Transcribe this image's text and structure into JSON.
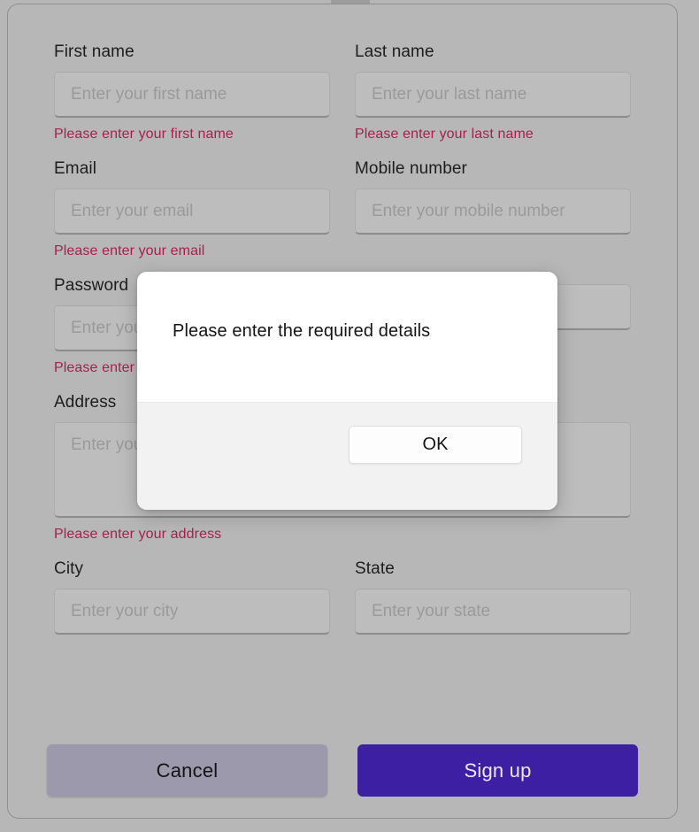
{
  "window": {
    "background_color": "#b7b7b7",
    "border_color": "#8f8f8f"
  },
  "form": {
    "fields": [
      {
        "name": "first-name",
        "label": "First name",
        "placeholder": "Enter your first name",
        "value": "",
        "error": "Please enter your first name",
        "type": "text"
      },
      {
        "name": "last-name",
        "label": "Last name",
        "placeholder": "Enter your last name",
        "value": "",
        "error": "Please enter your last name",
        "type": "text"
      },
      {
        "name": "email",
        "label": "Email",
        "placeholder": "Enter your email",
        "value": "",
        "error": "Please enter your email",
        "type": "text"
      },
      {
        "name": "mobile-number",
        "label": "Mobile number",
        "placeholder": "Enter your mobile number",
        "value": "",
        "error": "",
        "type": "text"
      },
      {
        "name": "password",
        "label": "Password",
        "placeholder": "Enter your password",
        "value": "",
        "error": "Please enter your password",
        "type": "password"
      },
      {
        "name": "confirm-password",
        "label": "",
        "placeholder": "",
        "value": "",
        "error": "",
        "type": "text"
      },
      {
        "name": "address",
        "label": "Address",
        "placeholder": "Enter your address",
        "value": "",
        "error": "Please enter your address",
        "type": "textarea"
      },
      {
        "name": "city",
        "label": "City",
        "placeholder": "Enter your city",
        "value": "",
        "error": "",
        "type": "text"
      },
      {
        "name": "state",
        "label": "State",
        "placeholder": "Enter your state",
        "value": "",
        "error": "",
        "type": "text"
      }
    ],
    "error_color": "#a8204c"
  },
  "actions": {
    "cancel_label": "Cancel",
    "signup_label": "Sign up",
    "cancel_color": "#9c99ad",
    "signup_color": "#3d1fa3"
  },
  "dialog": {
    "message": "Please enter the required details",
    "ok_label": "OK"
  }
}
